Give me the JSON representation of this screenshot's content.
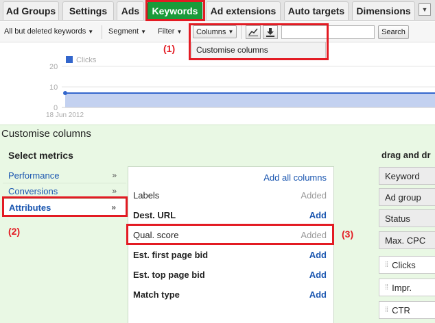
{
  "tabs": [
    "Ad Groups",
    "Settings",
    "Ads",
    "Keywords",
    "Ad extensions",
    "Auto targets",
    "Dimensions"
  ],
  "active_tab": "Keywords",
  "toolbar": {
    "filter_view": "All but deleted keywords",
    "segment": "Segment",
    "filter": "Filter",
    "columns": "Columns",
    "search_button": "Search",
    "search_value": ""
  },
  "columns_menu": {
    "item": "Customise columns"
  },
  "annotations": [
    "(1)",
    "(2)",
    "(3)"
  ],
  "chart": {
    "legend": "Clicks",
    "y_ticks": [
      "20",
      "10",
      "0"
    ],
    "x_label": "18 Jun 2012"
  },
  "chart_data": {
    "type": "area",
    "series": [
      {
        "name": "Clicks",
        "values": [
          7,
          7
        ]
      }
    ],
    "ylim": [
      0,
      20
    ],
    "x": [
      "18 Jun 2012"
    ]
  },
  "customise": {
    "title": "Customise columns",
    "select_metrics": "Select metrics",
    "drag_title": "drag and dr",
    "categories": [
      {
        "label": "Performance",
        "chevron": "»"
      },
      {
        "label": "Conversions",
        "chevron": "»"
      },
      {
        "label": "Attributes",
        "chevron": "»"
      }
    ],
    "add_all": "Add all columns",
    "metrics": [
      {
        "label": "Labels",
        "status": "Added"
      },
      {
        "label": "Dest. URL",
        "status": "Add"
      },
      {
        "label": "Qual. score",
        "status": "Added"
      },
      {
        "label": "Est. first page bid",
        "status": "Add"
      },
      {
        "label": "Est. top page bid",
        "status": "Add"
      },
      {
        "label": "Match type",
        "status": "Add"
      }
    ],
    "selected_columns": [
      "Keyword",
      "Ad group",
      "Status",
      "Max. CPC",
      "Clicks",
      "Impr.",
      "CTR"
    ]
  }
}
